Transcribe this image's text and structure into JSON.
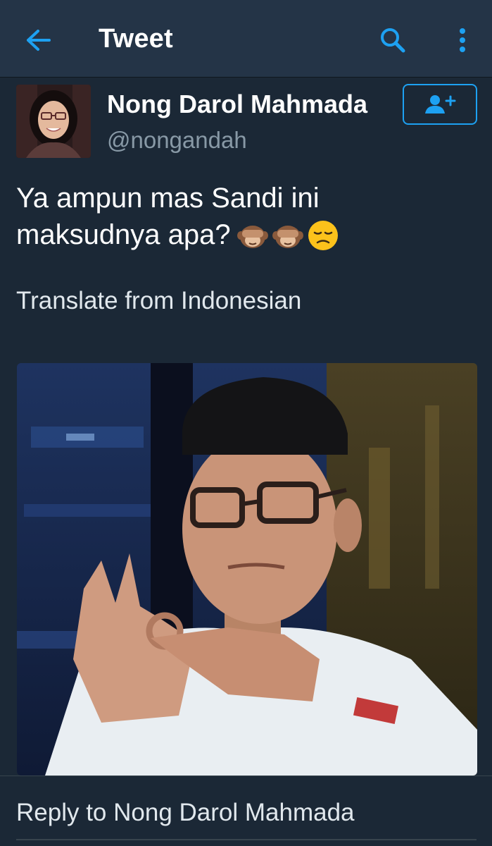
{
  "header": {
    "title": "Tweet",
    "back_icon": "arrow-left-icon",
    "search_icon": "search-icon",
    "more_icon": "more-vertical-icon"
  },
  "tweet": {
    "author": {
      "display_name": "Nong Darol Mahmada",
      "handle": "@nongandah",
      "follow_icon": "add-user-icon"
    },
    "text_line1": "Ya ampun mas Sandi ini",
    "text_line2": "maksudnya apa?",
    "emojis": [
      "see-no-evil-monkey-icon",
      "see-no-evil-monkey-icon",
      "disappointed-face-icon"
    ],
    "translate_label": "Translate from Indonesian"
  },
  "reply": {
    "placeholder": "Reply to Nong Darol Mahmada"
  },
  "colors": {
    "accent": "#1da1f2",
    "background": "#1b2836",
    "topbar": "#243447",
    "secondary_text": "#8899a6"
  }
}
